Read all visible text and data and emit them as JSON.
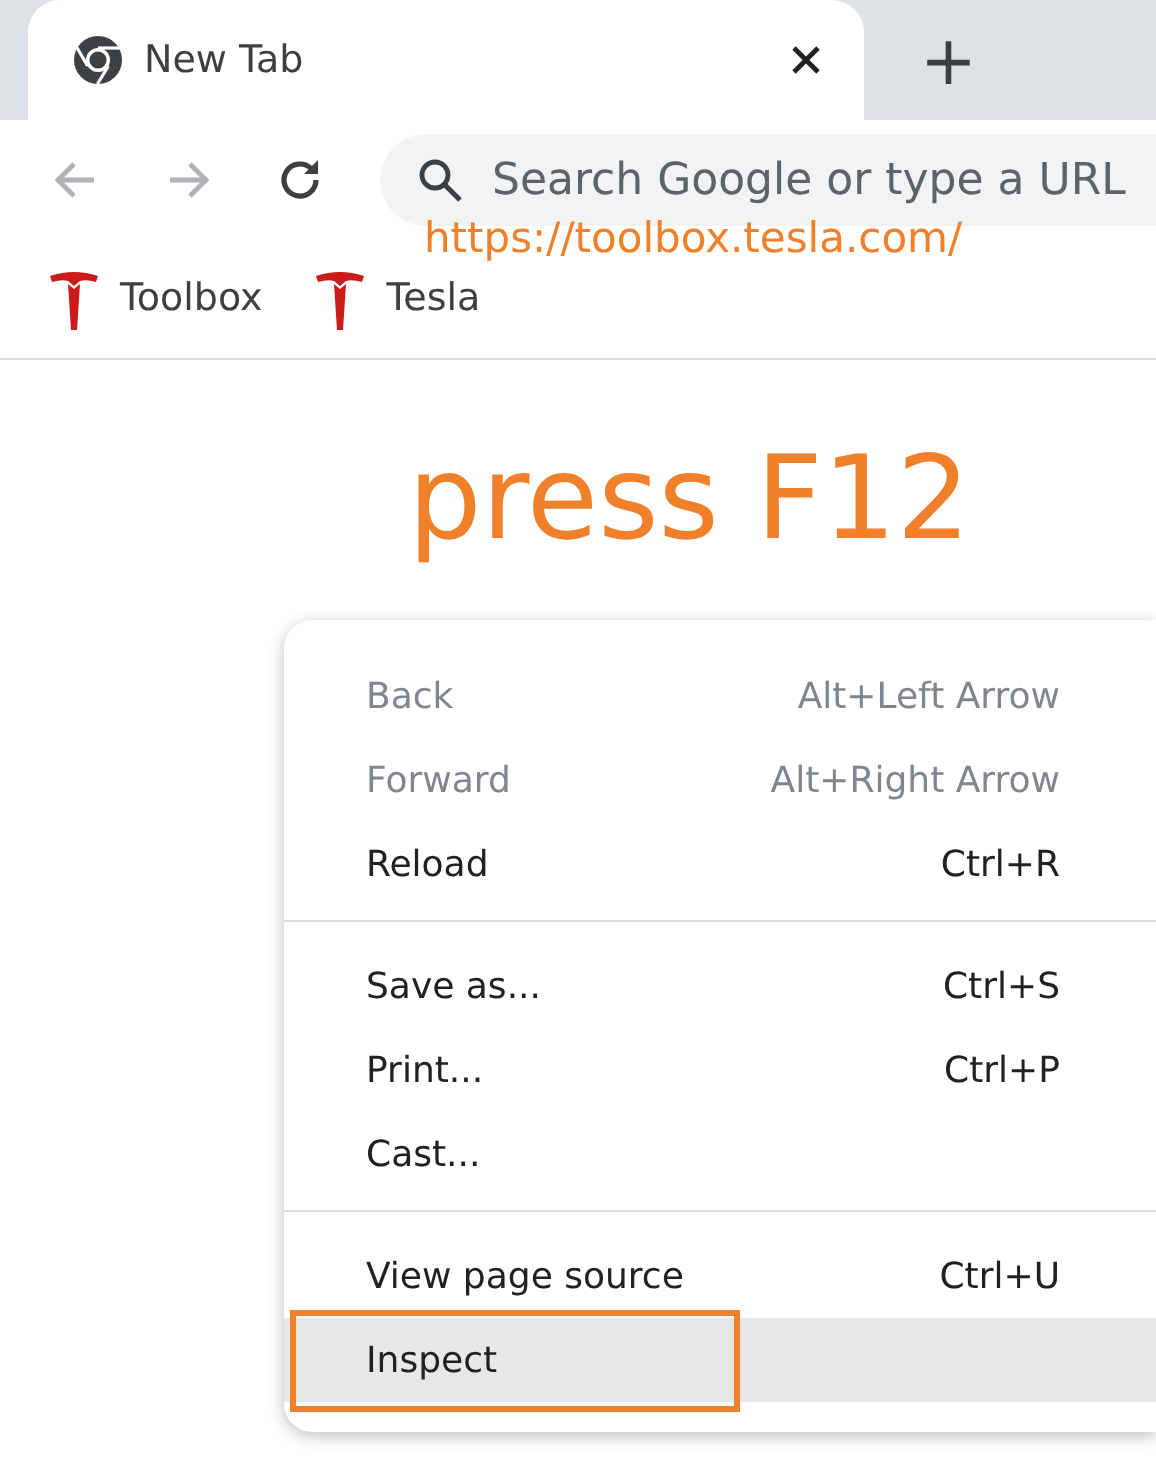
{
  "tab": {
    "title": "New Tab",
    "selected": true
  },
  "new_tab_button": "+",
  "navigation": [
    {
      "kind": "back",
      "disabled": true
    },
    {
      "kind": "forward",
      "disabled": true
    },
    {
      "kind": "reload",
      "disabled": false
    }
  ],
  "omnibox": {
    "placeholder": "Search Google or type a URL"
  },
  "bookmarks": [
    {
      "label": "Toolbox"
    },
    {
      "label": "Tesla"
    }
  ],
  "annotations": {
    "url_note": "https://toolbox.tesla.com/",
    "instruction": "press F12"
  },
  "context_menu": {
    "items": [
      {
        "kind": "item",
        "label": "Back",
        "shortcut": "Alt+Left Arrow",
        "disabled": true,
        "highlighted": false,
        "outlined": false
      },
      {
        "kind": "item",
        "label": "Forward",
        "shortcut": "Alt+Right Arrow",
        "disabled": true,
        "highlighted": false,
        "outlined": false
      },
      {
        "kind": "item",
        "label": "Reload",
        "shortcut": "Ctrl+R",
        "disabled": false,
        "highlighted": false,
        "outlined": false
      },
      {
        "kind": "separator"
      },
      {
        "kind": "item",
        "label": "Save as...",
        "shortcut": "Ctrl+S",
        "disabled": false,
        "highlighted": false,
        "outlined": false
      },
      {
        "kind": "item",
        "label": "Print...",
        "shortcut": "Ctrl+P",
        "disabled": false,
        "highlighted": false,
        "outlined": false
      },
      {
        "kind": "item",
        "label": "Cast...",
        "disabled": false,
        "highlighted": false,
        "outlined": false
      },
      {
        "kind": "separator"
      },
      {
        "kind": "item",
        "label": "View page source",
        "shortcut": "Ctrl+U",
        "disabled": false,
        "highlighted": false,
        "outlined": false
      },
      {
        "kind": "item",
        "label": "Inspect",
        "disabled": false,
        "highlighted": true,
        "outlined": true
      }
    ]
  }
}
